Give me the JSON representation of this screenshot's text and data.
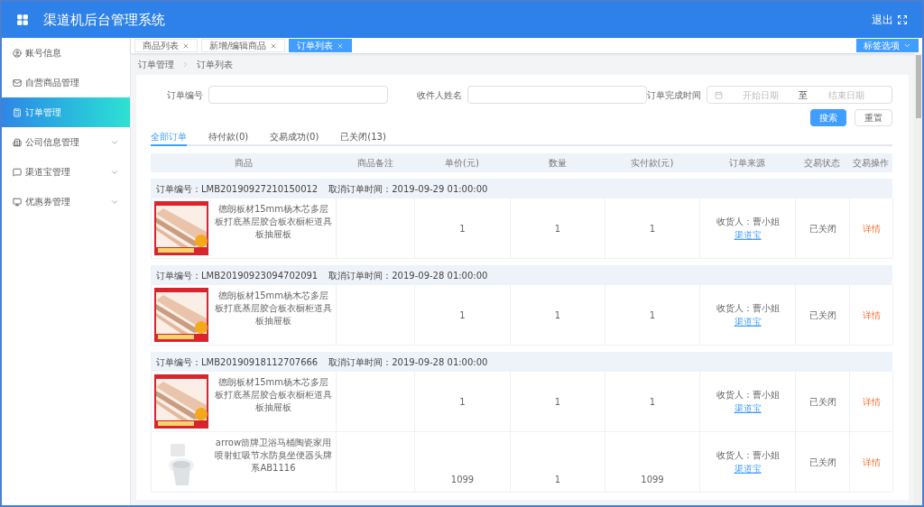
{
  "header": {
    "title": "渠道机后台管理系统",
    "logout": "退出"
  },
  "sidebar": {
    "items": [
      {
        "label": "账号信息",
        "selected": false,
        "expandable": false
      },
      {
        "label": "自营商品管理",
        "selected": false,
        "expandable": false
      },
      {
        "label": "订单管理",
        "selected": true,
        "expandable": false
      },
      {
        "label": "公司信息管理",
        "selected": false,
        "expandable": true
      },
      {
        "label": "渠道宝管理",
        "selected": false,
        "expandable": true
      },
      {
        "label": "优惠券管理",
        "selected": false,
        "expandable": true
      }
    ]
  },
  "page_tabs": [
    {
      "label": "商品列表",
      "selected": false
    },
    {
      "label": "新增/编辑商品",
      "selected": false
    },
    {
      "label": "订单列表",
      "selected": true
    }
  ],
  "tab_options": "标签选项",
  "breadcrumb": [
    "订单管理",
    "订单列表"
  ],
  "filters": {
    "order_no_label": "订单编号",
    "recipient_label": "收件人姓名",
    "date_label": "订单完成时间",
    "start_placeholder": "开始日期",
    "separator": "至",
    "end_placeholder": "结束日期",
    "search": "搜索",
    "reset": "重置"
  },
  "status_tabs": [
    {
      "label": "全部订单",
      "selected": true
    },
    {
      "label": "待付款(0)",
      "selected": false
    },
    {
      "label": "交易成功(0)",
      "selected": false
    },
    {
      "label": "已关闭(13)",
      "selected": false
    }
  ],
  "table": {
    "columns": [
      "商品",
      "商品备注",
      "单价(元)",
      "数量",
      "实付款(元)",
      "订单来源",
      "交易状态",
      "交易操作"
    ],
    "orders": [
      {
        "order_no": "订单编号：LMB20190927210150012",
        "cancel_time": "取消订单时间：2019-09-29 01:00:00",
        "items": [
          {
            "product": "德朗板材15mm杨木芯多层板打底基层胶合板衣橱柜道具板抽屉板",
            "price": "1",
            "qty": "1",
            "paid": "1",
            "receiver": "收货人：曹小姐",
            "source": "渠道宝",
            "status": "已关闭",
            "action": "详情"
          }
        ]
      },
      {
        "order_no": "订单编号：LMB20190923094702091",
        "cancel_time": "取消订单时间：2019-09-28 01:00:00",
        "items": [
          {
            "product": "德朗板材15mm杨木芯多层板打底基层胶合板衣橱柜道具板抽屉板",
            "price": "1",
            "qty": "1",
            "paid": "1",
            "receiver": "收货人：曹小姐",
            "source": "渠道宝",
            "status": "已关闭",
            "action": "详情"
          }
        ]
      },
      {
        "order_no": "订单编号：LMB20190918112707666",
        "cancel_time": "取消订单时间：2019-09-28 01:00:00",
        "items": [
          {
            "product": "德朗板材15mm杨木芯多层板打底基层胶合板衣橱柜道具板抽屉板",
            "price": "1",
            "qty": "1",
            "paid": "1",
            "receiver": "收货人：曹小姐",
            "source": "渠道宝",
            "status": "已关闭",
            "action": "详情"
          },
          {
            "product": "arrow箭牌卫浴马桶陶瓷家用喷射虹吸节水防臭坐便器头牌系AB1116",
            "price": "1099",
            "qty": "1",
            "paid": "1099",
            "receiver": "收货人：曹小姐",
            "source": "渠道宝",
            "status": "已关闭",
            "action": "详情"
          }
        ]
      }
    ]
  }
}
